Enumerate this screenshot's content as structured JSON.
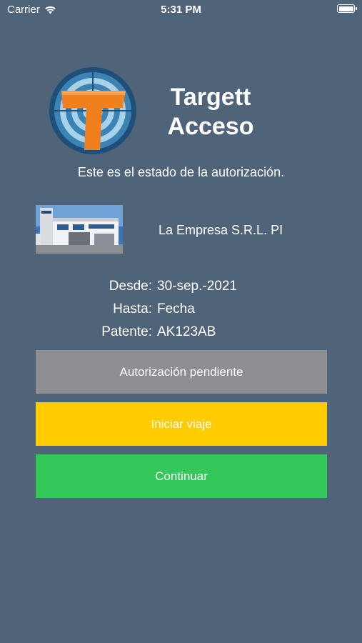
{
  "status_bar": {
    "carrier": "Carrier",
    "time": "5:31 PM"
  },
  "app": {
    "title_line1": "Targett",
    "title_line2": "Acceso"
  },
  "subtitle": "Este es el estado de la autorización.",
  "company": {
    "name": "La Empresa S.R.L. PI"
  },
  "authorization": {
    "desde_label": "Desde:",
    "desde_value": "30-sep.-2021",
    "hasta_label": "Hasta:",
    "hasta_value": "Fecha",
    "patente_label": "Patente:",
    "patente_value": "AK123AB"
  },
  "buttons": {
    "pending_label": "Autorización pendiente",
    "start_trip_label": "Iniciar viaje",
    "continue_label": "Continuar"
  },
  "colors": {
    "background": "#4f6379",
    "pending": "#8e8e93",
    "start_trip": "#ffcc00",
    "continue": "#34c759",
    "logo_orange": "#f07f1e"
  }
}
